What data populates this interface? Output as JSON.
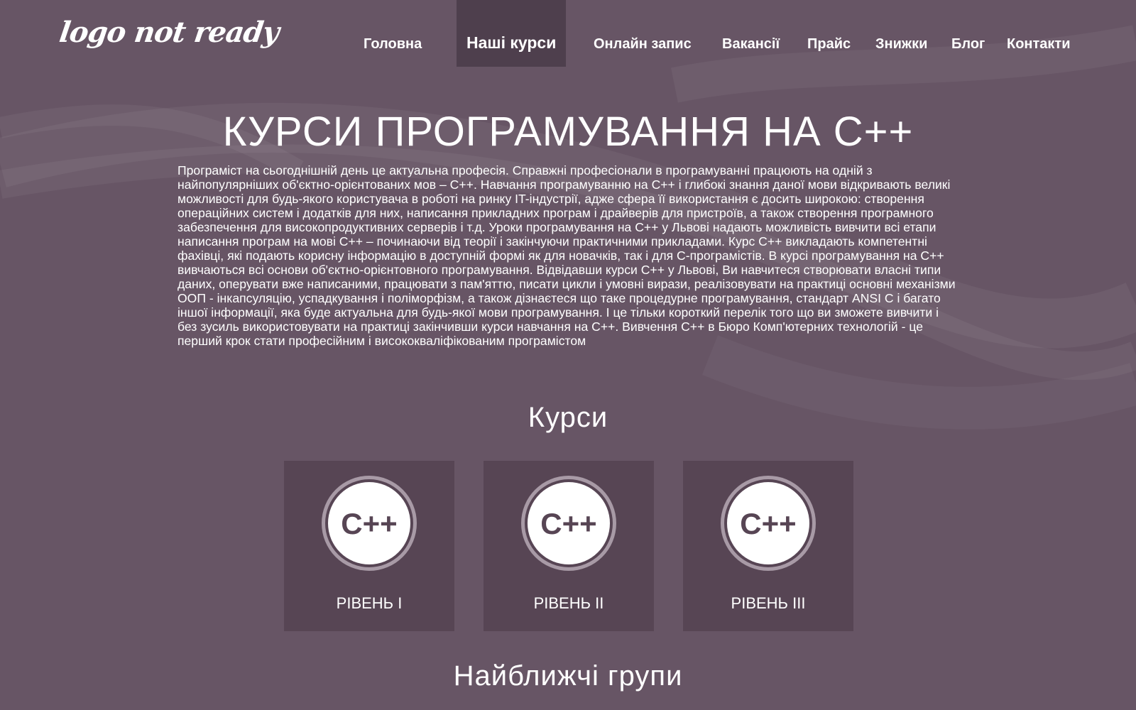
{
  "header": {
    "logo_text": "logo not ready",
    "nav": [
      {
        "label": "Головна",
        "active": false
      },
      {
        "label": "Наші курси",
        "active": true
      },
      {
        "label": "Онлайн запис",
        "active": false
      },
      {
        "label": "Вакансії",
        "active": false
      },
      {
        "label": "Прайс",
        "active": false
      },
      {
        "label": "Знижки",
        "active": false
      },
      {
        "label": "Блог",
        "active": false
      },
      {
        "label": "Контакти",
        "active": false
      }
    ]
  },
  "main": {
    "title": "КУРСИ ПРОГРАМУВАННЯ НА С++",
    "intro": "Програміст на сьогоднішній день це актуальна професія. Справжні професіонали в програмуванні працюють на одній з найпопулярніших об'єктно-орієнтованих мов – C++. Навчання програмуванню на C++ і глибокі знання даної мови відкривають великі можливості для будь-якого користувача в роботі на ринку IT-індустрії, адже сфера її використання є досить широкою: створення операційних систем і додатків для них, написання прикладних програм і драйверів для пристроїв, а також створення програмного забезпечення для високопродуктивних серверів і т.д. Уроки програмування на C++ у Львові надають можливість вивчити всі етапи написання програм на мові C++ – починаючи від теорії і закінчуючи практичними прикладами. Курс C++ викладають компетентні фахівці, які подають корисну інформацію в доступній формі як для новачків, так і для C-програмістів. В курсі програмування на C++ вивчаються всі основи об'єктно-орієнтовного програмування. Відвідавши курси C++ у Львові, Ви навчитеся створювати власні типи даних, оперувати вже написаними, працювати з пам'яттю, писати цикли і умовні вирази, реалізовувати на практиці основні механізми ООП - інкапсуляцію, успадкування і поліморфізм, а також дізнаєтеся що таке процедурне програмування, стандарт ANSI C і багато іншої інформації, яка буде актуальна для будь-якої мови програмування. І це тільки короткий перелік того що ви зможете вивчити і без зусиль використовувати на практиці закінчивши курси навчання на C++. Вивчення C++ в Бюро Комп'ютерних технологій - це перший крок стати професійним і висококваліфікованим програмістом",
    "courses_title": "Курси",
    "courses": [
      {
        "icon_text": "C++",
        "label": "РІВЕНЬ І"
      },
      {
        "icon_text": "C++",
        "label": "РІВЕНЬ ІІ"
      },
      {
        "icon_text": "C++",
        "label": "РІВЕНЬ ІІІ"
      }
    ],
    "groups_title": "Найближчі групи"
  },
  "colors": {
    "background": "#675565",
    "nav_active": "#4e3f4d",
    "card": "#574554",
    "icon_fill": "#ffffff",
    "icon_text": "#574554",
    "icon_ring": "#a89aa6"
  }
}
